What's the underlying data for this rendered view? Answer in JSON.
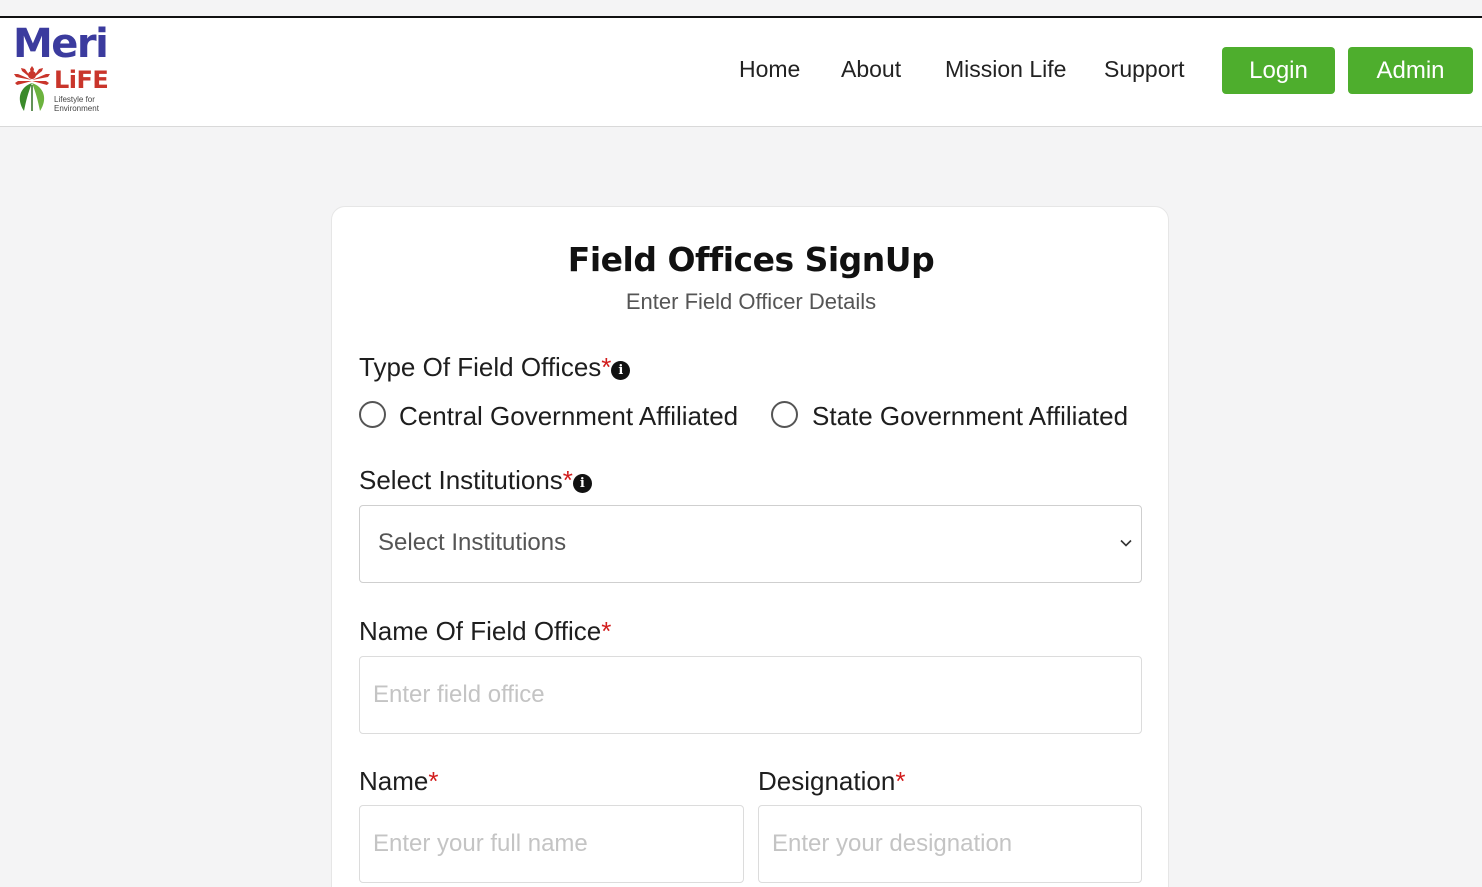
{
  "brand": {
    "logo_word": "Meri",
    "logo_life": "LiFE",
    "logo_tagline": "Lifestyle for Environment"
  },
  "nav": {
    "home": "Home",
    "about": "About",
    "mission_life": "Mission Life",
    "support": "Support",
    "login": "Login",
    "admin": "Admin"
  },
  "form": {
    "title": "Field Offices SignUp",
    "subtitle": "Enter Field Officer Details",
    "type_label": "Type Of Field Offices",
    "type_options": [
      "Central Government Affiliated",
      "State Government Affiliated"
    ],
    "institutions_label": "Select Institutions",
    "institutions_selected": "Select Institutions",
    "field_office_label": "Name Of Field Office",
    "field_office_placeholder": "Enter field office",
    "name_label": "Name",
    "name_placeholder": "Enter your full name",
    "designation_label": "Designation",
    "designation_placeholder": "Enter your designation",
    "required_marker": "*"
  },
  "colors": {
    "accent_green": "#4eae2d",
    "logo_blue": "#3b3b9e",
    "logo_red": "#c9352b",
    "required_red": "#d21c1c"
  },
  "icons": [
    "info-icon",
    "chevron-down-icon",
    "emblem-icon"
  ]
}
